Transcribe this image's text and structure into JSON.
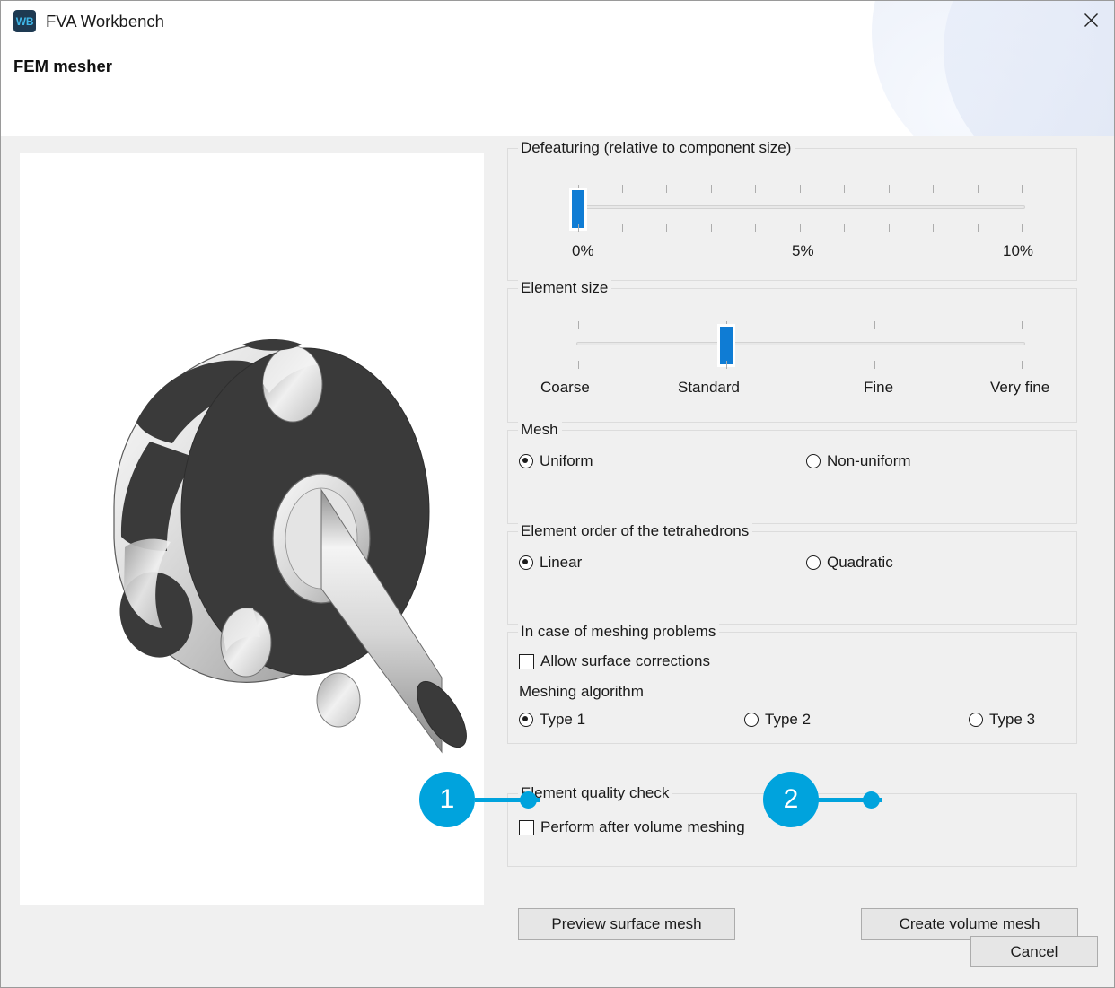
{
  "window": {
    "app_icon_text": "WB",
    "app_title": "FVA Workbench",
    "dialog_heading": "FEM mesher",
    "close_icon": "close-icon"
  },
  "preview": {
    "alt": "3D shaded CAD model of a flanged hub with shaft"
  },
  "defeaturing": {
    "legend": "Defeaturing (relative to component size)",
    "value_percent": 0,
    "min_percent": 0,
    "max_percent": 10,
    "tick_count": 11,
    "scale_labels": [
      "0%",
      "5%",
      "10%"
    ]
  },
  "element_size": {
    "legend": "Element size",
    "value": "Standard",
    "tick_count": 4,
    "scale_labels": [
      "Coarse",
      "Standard",
      "Fine",
      "Very fine"
    ]
  },
  "mesh": {
    "legend": "Mesh",
    "options": [
      {
        "label": "Uniform",
        "checked": true
      },
      {
        "label": "Non-uniform",
        "checked": false
      }
    ]
  },
  "element_order": {
    "legend": "Element order of the tetrahedrons",
    "options": [
      {
        "label": "Linear",
        "checked": true
      },
      {
        "label": "Quadratic",
        "checked": false
      }
    ]
  },
  "meshing_problems": {
    "legend": "In case of meshing problems",
    "allow_surface_corrections": {
      "label": "Allow surface corrections",
      "checked": false
    },
    "algorithm_label": "Meshing algorithm",
    "algorithm_options": [
      {
        "label": "Type 1",
        "checked": true
      },
      {
        "label": "Type 2",
        "checked": false
      },
      {
        "label": "Type 3",
        "checked": false
      }
    ]
  },
  "quality_check": {
    "legend": "Element quality check",
    "perform": {
      "label": "Perform after volume meshing",
      "checked": false
    }
  },
  "actions": {
    "preview_surface_mesh": "Preview surface mesh",
    "create_volume_mesh": "Create volume mesh",
    "cancel": "Cancel"
  },
  "callouts": [
    {
      "number": "1",
      "target": "preview-surface-mesh-button"
    },
    {
      "number": "2",
      "target": "create-volume-mesh-button"
    }
  ],
  "colors": {
    "accent_callout": "#00a3dd",
    "slider_thumb": "#0f7cd4",
    "window_bg": "#f0f0f0",
    "header_bg": "#ffffff",
    "app_icon_bg": "#1e3a52",
    "app_icon_fg": "#3fb7e8"
  }
}
